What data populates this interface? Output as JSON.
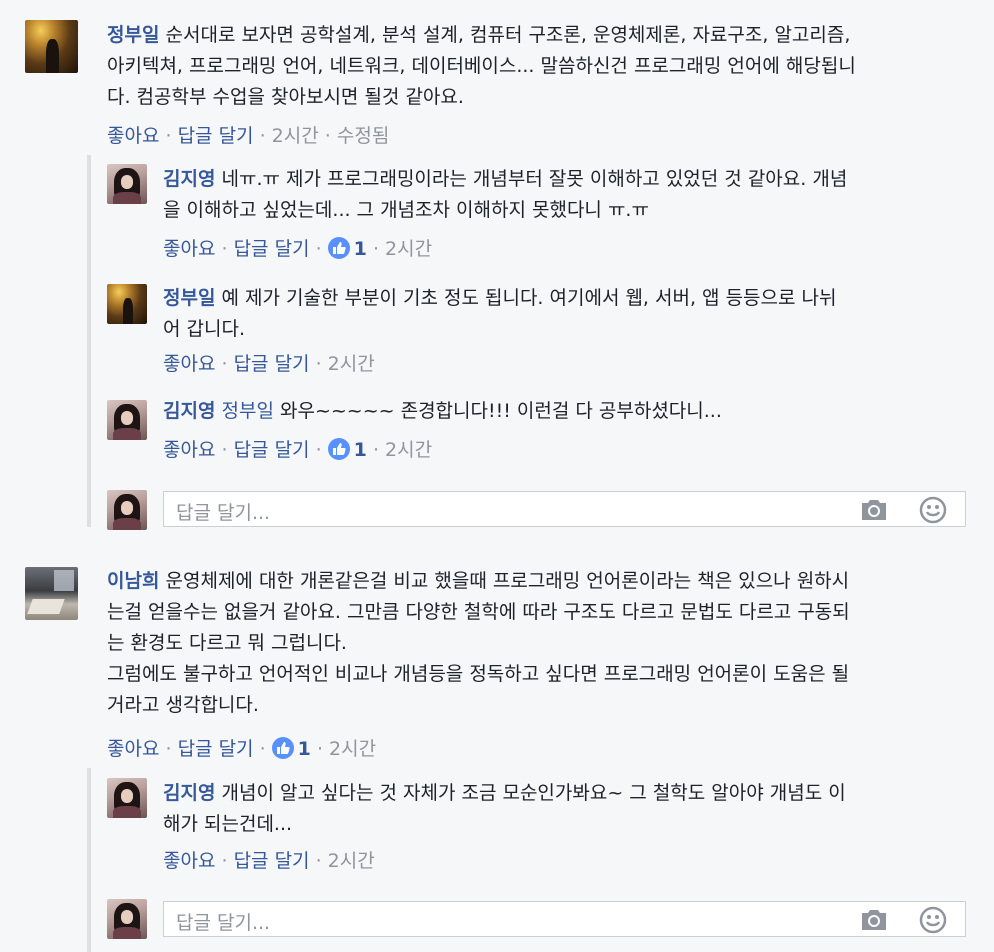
{
  "comments": [
    {
      "author": "정부일",
      "text1": "순서대로 보자면 공학설계, 분석 설계, 컴퓨터 구조론, 운영체제론, 자료구조, 알고리즘,",
      "text2": "아키텍쳐, 프로그래밍 언어, 네트워크, 데이터베이스... 말씀하신건 프로그래밍 언어에 해당됩니",
      "text3": "다. 컴공학부 수업을 찾아보시면 될것 같아요.",
      "like_label": "좋아요",
      "reply_label": "답글 달기",
      "time": "2시간",
      "edited": "수정됨"
    },
    {
      "author": "김지영",
      "text1": "네ㅠ.ㅠ 제가 프로그래밍이라는 개념부터 잘못 이해하고 있었던 것 같아요. 개념",
      "text2": "을 이해하고 싶었는데... 그 개념조차 이해하지 못했다니 ㅠ.ㅠ",
      "like_label": "좋아요",
      "reply_label": "답글 달기",
      "likes": "1",
      "time": "2시간"
    },
    {
      "author": "정부일",
      "text1": "예 제가 기술한 부분이 기초 정도 됩니다. 여기에서 웹, 서버, 앱 등등으로 나뉘",
      "text2": "어 갑니다.",
      "like_label": "좋아요",
      "reply_label": "답글 달기",
      "time": "2시간"
    },
    {
      "author": "김지영",
      "tagged": "정부일",
      "text1": "와우~~~~~ 존경합니다!!! 이런걸 다 공부하셨다니...",
      "like_label": "좋아요",
      "reply_label": "답글 달기",
      "likes": "1",
      "time": "2시간"
    },
    {
      "author": "이남희",
      "text1": "운영체제에 대한 개론같은걸 비교 했을때 프로그래밍 언어론이라는 책은 있으나 원하시",
      "text2": "는걸 얻을수는 없을거 같아요. 그만큼 다양한 철학에 따라 구조도 다르고 문법도 다르고 구동되",
      "text3": "는 환경도 다르고 뭐 그럽니다.",
      "text4": "그럼에도 불구하고 언어적인 비교나 개념등을 정독하고 싶다면 프로그래밍 언어론이 도움은 될",
      "text5": "거라고 생각합니다.",
      "like_label": "좋아요",
      "reply_label": "답글 달기",
      "likes": "1",
      "time": "2시간"
    },
    {
      "author": "김지영",
      "text1": "개념이 알고 싶다는 것 자체가 조금 모순인가봐요~ 그 철학도 알아야 개념도 이",
      "text2": "해가 되는건데...",
      "like_label": "좋아요",
      "reply_label": "답글 달기",
      "time": "2시간"
    }
  ],
  "reply_input": {
    "placeholder": "답글 달기..."
  },
  "icons": {
    "camera": "camera-icon",
    "emoji": "smiley-icon",
    "like": "thumbs-up-icon"
  },
  "colors": {
    "name": "#365899",
    "meta": "#90949c",
    "like_badge": "#5890ff",
    "background": "#f6f7f9"
  }
}
